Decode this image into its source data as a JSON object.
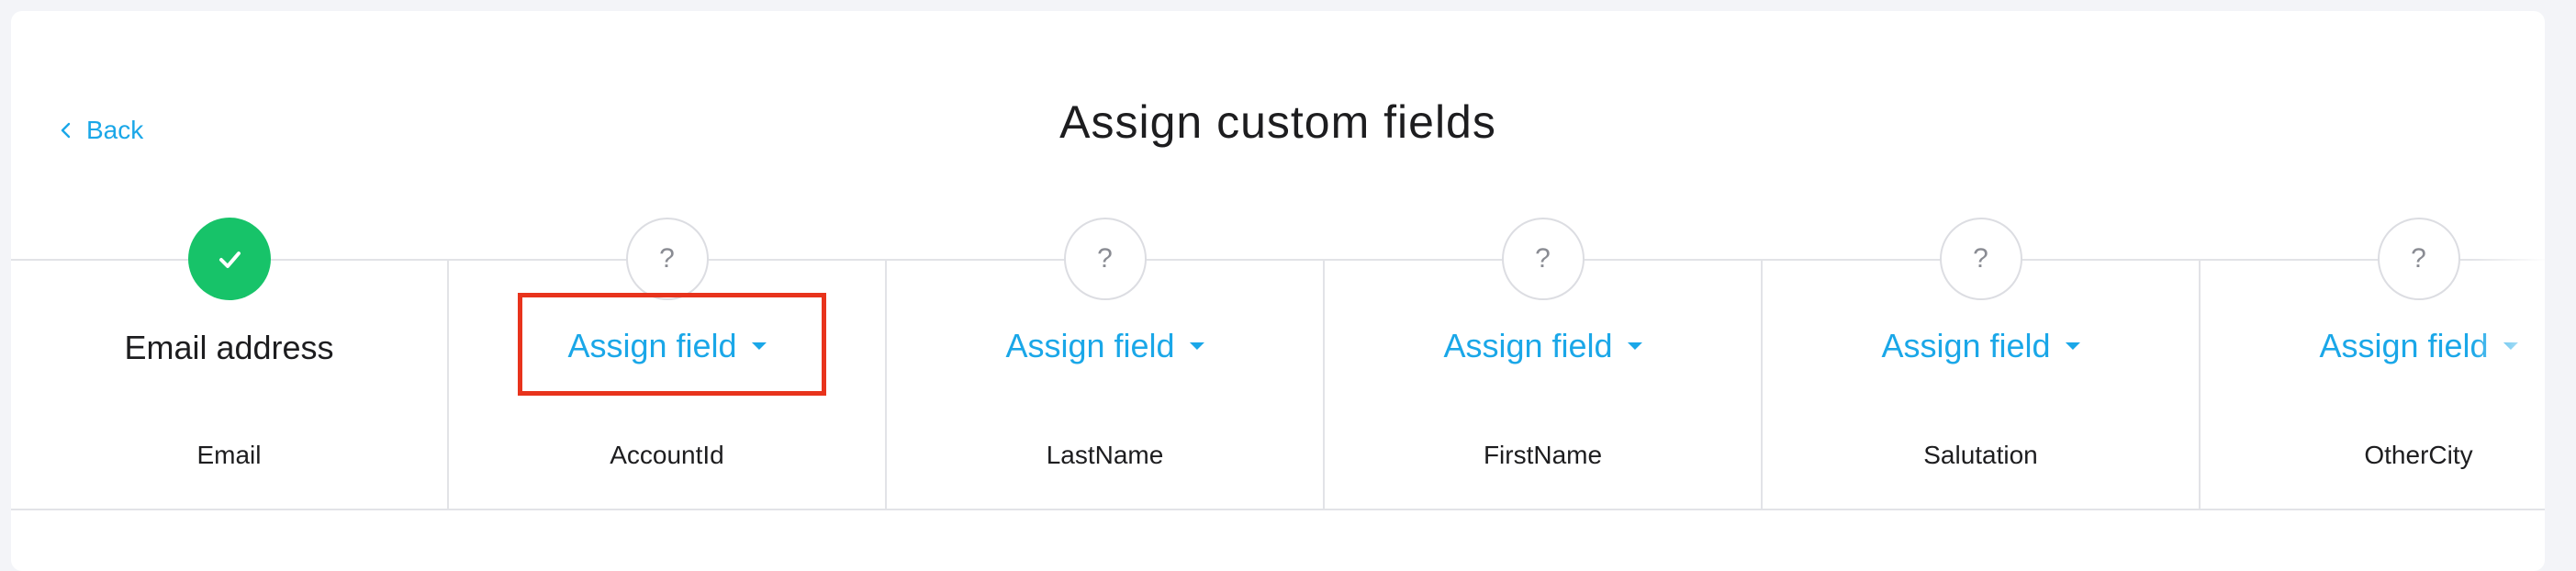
{
  "header": {
    "back_label": "Back",
    "title": "Assign custom fields"
  },
  "columns": [
    {
      "status": "assigned",
      "primary": "Email address",
      "field": "Email"
    },
    {
      "status": "unassigned",
      "status_glyph": "?",
      "action": "Assign field",
      "field": "AccountId"
    },
    {
      "status": "unassigned",
      "status_glyph": "?",
      "action": "Assign field",
      "field": "LastName"
    },
    {
      "status": "unassigned",
      "status_glyph": "?",
      "action": "Assign field",
      "field": "FirstName"
    },
    {
      "status": "unassigned",
      "status_glyph": "?",
      "action": "Assign field",
      "field": "Salutation"
    },
    {
      "status": "unassigned",
      "status_glyph": "?",
      "action": "Assign field",
      "field": "OtherCity"
    }
  ],
  "colors": {
    "accent": "#1aa7e8",
    "success": "#17c369",
    "highlight": "#e8331c"
  }
}
